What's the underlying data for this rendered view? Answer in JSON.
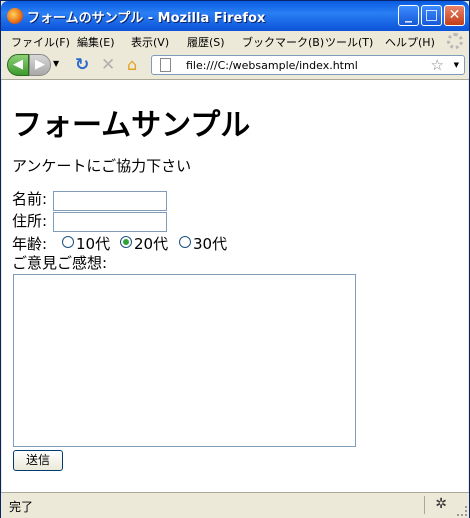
{
  "window": {
    "title": "フォームのサンプル - Mozilla Firefox",
    "minimize_glyph": "_",
    "maximize_glyph": "□",
    "close_glyph": "✕"
  },
  "menu": {
    "items": [
      {
        "label": "ファイル(F)"
      },
      {
        "label": "編集(E)"
      },
      {
        "label": "表示(V)"
      },
      {
        "label": "履歴(S)"
      },
      {
        "label": "ブックマーク(B)"
      },
      {
        "label": "ツール(T)"
      },
      {
        "label": "ヘルプ(H)"
      }
    ]
  },
  "toolbar": {
    "back_glyph": "◀",
    "forward_glyph": "▶",
    "dropdown_glyph": "▼",
    "reload_glyph": "↻",
    "stop_glyph": "✕",
    "home_glyph": "⌂",
    "url": "file:///C:/websample/index.html",
    "bookmark_glyph": "☆"
  },
  "page": {
    "heading": "フォームサンプル",
    "intro": "アンケートにご協力下さい",
    "form": {
      "name_label": "名前:",
      "name_value": "",
      "address_label": "住所:",
      "address_value": "",
      "age_label": "年齢:",
      "age_options": [
        {
          "label": "10代",
          "checked": false
        },
        {
          "label": "20代",
          "checked": true
        },
        {
          "label": "30代",
          "checked": false
        }
      ],
      "comments_label": "ご意見ご感想:",
      "comments_value": "",
      "submit_label": "送信"
    }
  },
  "status": {
    "text": "完了",
    "bug_glyph": "✲"
  },
  "colors": {
    "titlebar": "#0b52d8",
    "input_border": "#7f9db9",
    "radio_checked": "#2fa32f"
  }
}
